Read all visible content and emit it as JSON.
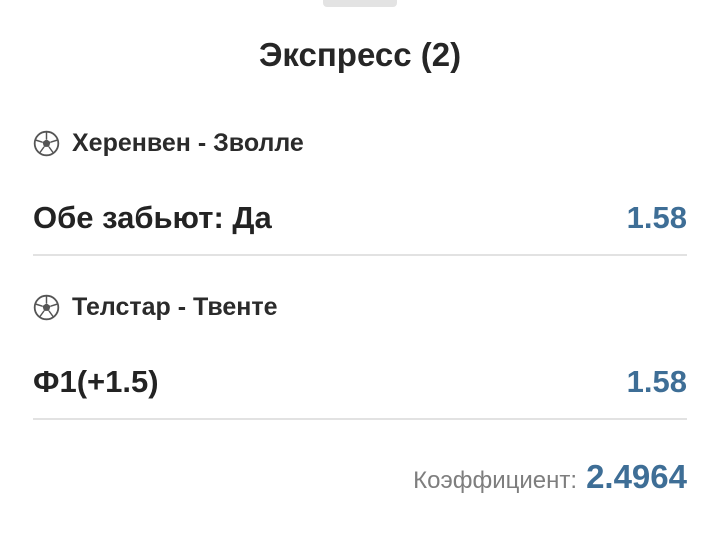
{
  "title": "Экспресс (2)",
  "events": [
    {
      "icon": "soccer-ball-icon",
      "match": "Херенвен - Зволле",
      "bet": "Обе забьют: Да",
      "odd": "1.58"
    },
    {
      "icon": "soccer-ball-icon",
      "match": "Телстар - Твенте",
      "bet": "Ф1(+1.5)",
      "odd": "1.58"
    }
  ],
  "total": {
    "label": "Коэффициент:",
    "value": "2.4964"
  },
  "colors": {
    "accent": "#3e6e96",
    "text": "#232323",
    "muted": "#7e7e7e",
    "divider": "#e2e2e2"
  }
}
